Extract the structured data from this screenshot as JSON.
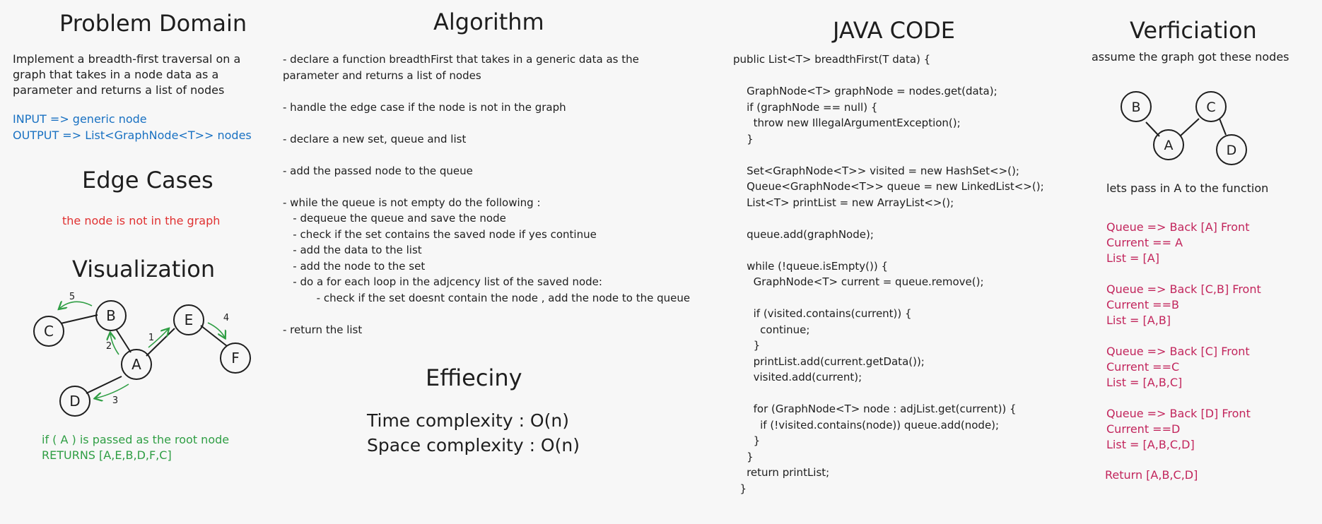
{
  "colors": {
    "background": "#f7f7f7",
    "ink": "#1e1e1e",
    "input_output": "#1971c2",
    "edge_case": "#e03131",
    "visual_arrows": "#2f9e44",
    "trace": "#c2255c"
  },
  "problem": {
    "title": "Problem Domain",
    "text": "Implement a breadth-first traversal on a\ngraph that takes in a node data as a\nparameter and returns a list of nodes",
    "input": "INPUT => generic node",
    "output": "OUTPUT => List<GraphNode<T>> nodes"
  },
  "edge_cases": {
    "title": "Edge Cases",
    "text": "the node is not in the graph"
  },
  "visualization": {
    "title": "Visualization",
    "nodes": [
      "C",
      "B",
      "E",
      "F",
      "A",
      "D"
    ],
    "order_labels": [
      "5",
      "2",
      "1",
      "4",
      "3"
    ],
    "result": "if ( A ) is passed as the root node\nRETURNS [A,E,B,D,F,C]"
  },
  "algorithm": {
    "title": "Algorithm",
    "text": "- declare a function breadthFirst that takes in a generic data as the\nparameter and returns a list of nodes\n\n- handle the edge case if the node is not in the graph\n\n- declare a new set, queue and list\n\n- add the passed node to the queue\n\n- while the queue is not empty do the following :\n   - dequeue the queue and save the node\n   - check if the set contains the saved node if yes continue\n   - add the data to the list\n   - add the node to the set\n   - do a for each loop in the adjcency list of the saved node:\n          - check if the set doesnt contain the node , add the node to the queue\n\n- return the list"
  },
  "efficiency": {
    "title": "Effieciny",
    "time": "Time complexity : O(n)",
    "space": "Space complexity : O(n)"
  },
  "java": {
    "title": "JAVA CODE",
    "code": "public List<T> breadthFirst(T data) {\n\n    GraphNode<T> graphNode = nodes.get(data);\n    if (graphNode == null) {\n      throw new IllegalArgumentException();\n    }\n\n    Set<GraphNode<T>> visited = new HashSet<>();\n    Queue<GraphNode<T>> queue = new LinkedList<>();\n    List<T> printList = new ArrayList<>();\n\n    queue.add(graphNode);\n\n    while (!queue.isEmpty()) {\n      GraphNode<T> current = queue.remove();\n\n      if (visited.contains(current)) {\n        continue;\n      }\n      printList.add(current.getData());\n      visited.add(current);\n\n      for (GraphNode<T> node : adjList.get(current)) {\n        if (!visited.contains(node)) queue.add(node);\n      }\n    }\n    return printList;\n  }"
  },
  "verification": {
    "title": "Verficiation",
    "subtitle": "assume the graph got these nodes",
    "nodes": [
      "B",
      "C",
      "A",
      "D"
    ],
    "pass_text": "lets pass in A to the function",
    "steps": [
      "Queue => Back [A] Front\nCurrent == A\nList = [A]",
      "Queue => Back [C,B] Front\nCurrent ==B\nList = [A,B]",
      "Queue => Back [C] Front\nCurrent ==C\nList = [A,B,C]",
      "Queue => Back [D] Front\nCurrent ==D\nList = [A,B,C,D]"
    ],
    "return": "Return [A,B,C,D]"
  }
}
